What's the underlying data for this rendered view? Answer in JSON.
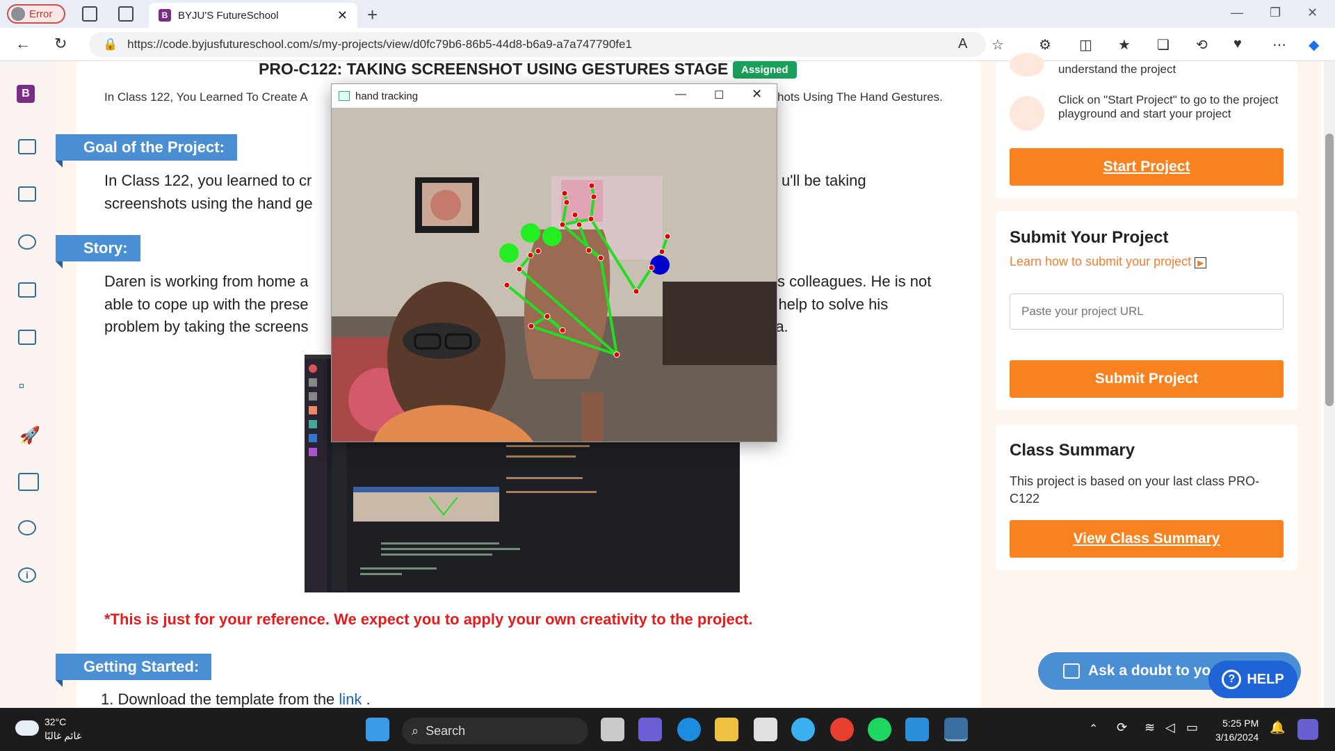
{
  "browser": {
    "error_label": "Error",
    "tab_title": "BYJU'S FutureSchool",
    "tab_favicon_letter": "B",
    "url": "https://code.byjusfutureschool.com/s/my-projects/view/d0fc79b6-86b5-44d8-b6a9-a7a747790fe1"
  },
  "page": {
    "title": "PRO-C122: TAKING SCREENSHOT USING GESTURES STAGE 1",
    "status_badge": "Assigned",
    "intro_left": "In Class 122, You Learned To Create A",
    "intro_right": "hots Using The Hand Gestures.",
    "goal_heading": "Goal of the Project:",
    "goal_line1_left": "In Class 122, you learned to cr",
    "goal_line1_right": "u'll be taking",
    "goal_line2_left": "screenshots using the hand ge",
    "story_heading": "Story:",
    "story_line1_left": "Daren is working from home a",
    "story_line1_right": "s colleagues. He is not",
    "story_line2_left": "able to cope up with the prese",
    "story_line2_right": "r help to solve his",
    "story_line3_left": "problem by taking the screens",
    "story_line3_right": "ra.",
    "reference_note": "*This is just for your reference. We expect you to apply your own creativity to the project.",
    "getting_started_heading": "Getting Started:",
    "step1_text": "1. Download the template from the",
    "step1_link": "link",
    "step1_end": "."
  },
  "overlay_window": {
    "title": "hand tracking",
    "landmark_color": "#e00000",
    "connection_color": "#22dd22",
    "fingertip_color": "#22ee22",
    "thumb_tip_color": "#0000cc"
  },
  "right_panel": {
    "step_a": "understand the project",
    "step_b": "Click on \"Start Project\" to go to the project playground and start your project",
    "start_button": "Start Project",
    "submit_heading": "Submit Your Project",
    "learn_link": "Learn how to submit your project",
    "url_placeholder": "Paste your project URL",
    "submit_button": "Submit Project",
    "summary_heading": "Class Summary",
    "summary_text": "This project is based on your last class PRO-C122",
    "summary_button": "View Class Summary",
    "ask_doubt": "Ask a doubt to yo",
    "help_button": "HELP",
    "accent_color": "#f7821f"
  },
  "taskbar": {
    "temperature": "32°C",
    "weather_desc": "غائم غالبًا",
    "search_label": "Search",
    "time": "5:25 PM",
    "date": "3/16/2024"
  }
}
